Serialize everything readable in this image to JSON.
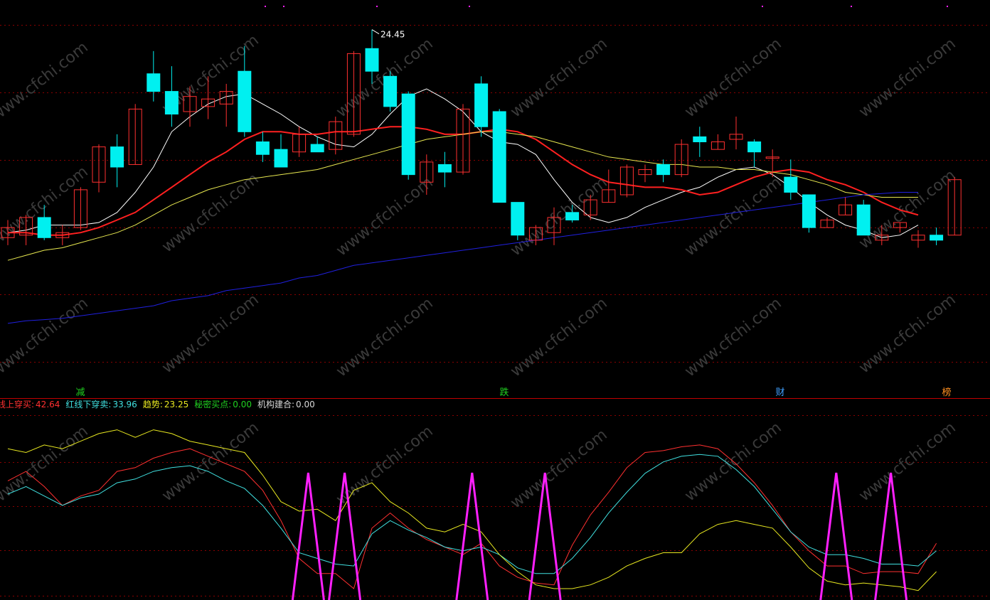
{
  "chart_data": [
    {
      "type": "candlestick",
      "peak_label": "24.45",
      "ylim": [
        10.4,
        25.4
      ],
      "moving_averages": [
        {
          "color": "#ffffff",
          "values": [
            16.4,
            16.5,
            16.7,
            16.7,
            16.7,
            16.8,
            17.2,
            18.0,
            19.0,
            20.4,
            21.0,
            21.5,
            21.8,
            21.9,
            21.5,
            21.1,
            20.6,
            20.2,
            19.9,
            19.8,
            20.3,
            21.1,
            21.8,
            22.1,
            21.7,
            21.2,
            20.4,
            20.0,
            19.9,
            19.5,
            18.5,
            17.6,
            17.0,
            16.8,
            17.0,
            17.4,
            17.7,
            18.0,
            18.2,
            18.6,
            18.9,
            19.0,
            18.7,
            18.2,
            17.6,
            17.1,
            16.7,
            16.5,
            16.2,
            16.3,
            16.7
          ]
        },
        {
          "color": "#ff2020",
          "values": [
            16.4,
            16.4,
            16.3,
            16.3,
            16.4,
            16.6,
            16.9,
            17.2,
            17.7,
            18.2,
            18.7,
            19.2,
            19.6,
            20.1,
            20.4,
            20.4,
            20.3,
            20.3,
            20.4,
            20.4,
            20.5,
            20.6,
            20.6,
            20.5,
            20.3,
            20.3,
            20.4,
            20.5,
            20.4,
            20.1,
            19.6,
            19.1,
            18.7,
            18.4,
            18.3,
            18.2,
            18.2,
            18.1,
            17.9,
            18.0,
            18.3,
            18.6,
            18.8,
            18.9,
            18.8,
            18.5,
            18.3,
            18.0,
            17.6,
            17.3,
            17.1
          ]
        },
        {
          "color": "#e8e850",
          "values": [
            15.3,
            15.5,
            15.7,
            15.8,
            16.0,
            16.2,
            16.4,
            16.7,
            17.1,
            17.5,
            17.8,
            18.1,
            18.3,
            18.5,
            18.6,
            18.7,
            18.8,
            18.9,
            19.1,
            19.3,
            19.5,
            19.7,
            19.9,
            20.1,
            20.2,
            20.3,
            20.4,
            20.4,
            20.3,
            20.2,
            20.0,
            19.8,
            19.6,
            19.4,
            19.3,
            19.2,
            19.1,
            19.1,
            19.0,
            19.0,
            18.9,
            18.9,
            18.8,
            18.7,
            18.5,
            18.3,
            18.0,
            17.9,
            17.8,
            17.8,
            17.8
          ]
        },
        {
          "color": "#2020e0",
          "values": [
            12.8,
            12.9,
            12.95,
            13.0,
            13.1,
            13.2,
            13.3,
            13.4,
            13.5,
            13.7,
            13.8,
            13.9,
            14.1,
            14.2,
            14.3,
            14.4,
            14.6,
            14.7,
            14.9,
            15.1,
            15.2,
            15.3,
            15.4,
            15.5,
            15.6,
            15.7,
            15.8,
            15.9,
            16.0,
            16.1,
            16.2,
            16.3,
            16.4,
            16.5,
            16.6,
            16.7,
            16.8,
            16.9,
            17.0,
            17.1,
            17.2,
            17.3,
            17.4,
            17.5,
            17.6,
            17.7,
            17.8,
            17.9,
            17.95,
            18.0,
            18.0
          ]
        }
      ],
      "candles": [
        {
          "o": 16.2,
          "h": 16.9,
          "l": 15.9,
          "c": 16.6
        },
        {
          "o": 16.3,
          "h": 17.1,
          "l": 15.9,
          "c": 17.0
        },
        {
          "o": 17.0,
          "h": 17.5,
          "l": 16.1,
          "c": 16.2
        },
        {
          "o": 16.2,
          "h": 16.7,
          "l": 15.9,
          "c": 16.4
        },
        {
          "o": 16.6,
          "h": 18.2,
          "l": 16.5,
          "c": 18.1
        },
        {
          "o": 18.4,
          "h": 19.9,
          "l": 18.0,
          "c": 19.8
        },
        {
          "o": 19.8,
          "h": 20.3,
          "l": 18.2,
          "c": 19.0
        },
        {
          "o": 19.1,
          "h": 21.5,
          "l": 19.1,
          "c": 21.3
        },
        {
          "o": 22.7,
          "h": 23.6,
          "l": 21.6,
          "c": 22.0
        },
        {
          "o": 22.0,
          "h": 23.0,
          "l": 20.6,
          "c": 21.1
        },
        {
          "o": 21.2,
          "h": 22.2,
          "l": 20.6,
          "c": 21.8
        },
        {
          "o": 21.4,
          "h": 22.6,
          "l": 20.9,
          "c": 21.7
        },
        {
          "o": 21.5,
          "h": 22.3,
          "l": 20.6,
          "c": 22.0
        },
        {
          "o": 22.8,
          "h": 23.8,
          "l": 20.2,
          "c": 20.4
        },
        {
          "o": 20.0,
          "h": 20.4,
          "l": 19.2,
          "c": 19.5
        },
        {
          "o": 19.7,
          "h": 20.3,
          "l": 19.1,
          "c": 19.0
        },
        {
          "o": 19.6,
          "h": 20.6,
          "l": 19.4,
          "c": 20.3
        },
        {
          "o": 19.9,
          "h": 20.2,
          "l": 19.7,
          "c": 19.6
        },
        {
          "o": 19.7,
          "h": 21.0,
          "l": 19.5,
          "c": 20.8
        },
        {
          "o": 20.3,
          "h": 23.6,
          "l": 20.2,
          "c": 23.5
        },
        {
          "o": 23.7,
          "h": 24.45,
          "l": 22.3,
          "c": 22.8
        },
        {
          "o": 22.6,
          "h": 22.8,
          "l": 21.2,
          "c": 21.4
        },
        {
          "o": 21.9,
          "h": 22.0,
          "l": 18.5,
          "c": 18.7
        },
        {
          "o": 18.4,
          "h": 19.5,
          "l": 17.9,
          "c": 19.2
        },
        {
          "o": 19.1,
          "h": 19.6,
          "l": 18.2,
          "c": 18.8
        },
        {
          "o": 18.8,
          "h": 21.5,
          "l": 18.7,
          "c": 21.3
        },
        {
          "o": 22.3,
          "h": 22.6,
          "l": 20.2,
          "c": 20.6
        },
        {
          "o": 21.2,
          "h": 21.3,
          "l": 17.6,
          "c": 17.6
        },
        {
          "o": 17.6,
          "h": 17.6,
          "l": 16.1,
          "c": 16.3
        },
        {
          "o": 16.1,
          "h": 16.7,
          "l": 15.9,
          "c": 16.6
        },
        {
          "o": 16.4,
          "h": 17.4,
          "l": 15.9,
          "c": 17.0
        },
        {
          "o": 17.2,
          "h": 17.5,
          "l": 16.8,
          "c": 16.9
        },
        {
          "o": 17.1,
          "h": 17.9,
          "l": 16.9,
          "c": 17.7
        },
        {
          "o": 17.6,
          "h": 18.9,
          "l": 17.6,
          "c": 18.1
        },
        {
          "o": 17.9,
          "h": 19.1,
          "l": 17.8,
          "c": 19.0
        },
        {
          "o": 18.7,
          "h": 19.1,
          "l": 18.4,
          "c": 18.9
        },
        {
          "o": 19.1,
          "h": 19.3,
          "l": 18.4,
          "c": 18.7
        },
        {
          "o": 18.7,
          "h": 20.1,
          "l": 18.6,
          "c": 19.9
        },
        {
          "o": 20.2,
          "h": 20.6,
          "l": 19.4,
          "c": 20.0
        },
        {
          "o": 19.7,
          "h": 20.3,
          "l": 19.7,
          "c": 20.0
        },
        {
          "o": 20.1,
          "h": 21.0,
          "l": 19.7,
          "c": 20.3
        },
        {
          "o": 20.0,
          "h": 20.1,
          "l": 19.0,
          "c": 19.6
        },
        {
          "o": 19.4,
          "h": 19.7,
          "l": 18.6,
          "c": 19.4
        },
        {
          "o": 18.6,
          "h": 19.3,
          "l": 17.7,
          "c": 18.0
        },
        {
          "o": 17.9,
          "h": 17.9,
          "l": 16.4,
          "c": 16.6
        },
        {
          "o": 16.6,
          "h": 17.0,
          "l": 16.6,
          "c": 16.9
        },
        {
          "o": 17.1,
          "h": 17.8,
          "l": 17.1,
          "c": 17.5
        },
        {
          "o": 17.5,
          "h": 17.7,
          "l": 16.3,
          "c": 16.3
        },
        {
          "o": 16.1,
          "h": 16.7,
          "l": 15.9,
          "c": 16.3
        },
        {
          "o": 16.6,
          "h": 16.8,
          "l": 16.4,
          "c": 16.8
        },
        {
          "o": 16.1,
          "h": 16.5,
          "l": 15.8,
          "c": 16.3
        },
        {
          "o": 16.3,
          "h": 16.6,
          "l": 15.9,
          "c": 16.1
        },
        {
          "o": 16.3,
          "h": 18.6,
          "l": 16.3,
          "c": 18.5
        }
      ]
    },
    {
      "type": "line",
      "ylim": [
        0,
        100
      ],
      "legend": [
        {
          "label": "线上穿买:",
          "value": "42.64",
          "color": "#ff3030"
        },
        {
          "label": "红线下穿卖:",
          "value": "33.96",
          "color": "#40e0e0"
        },
        {
          "label": "趋势:",
          "value": "23.25",
          "color": "#e8e820"
        },
        {
          "label": "秘密买点:",
          "value": "0.00",
          "color": "#20d020"
        },
        {
          "label": "机构建合:",
          "value": "0.00",
          "color": "#d8d8d8"
        }
      ],
      "series": [
        {
          "color": "#ff3030",
          "values": [
            63,
            68,
            60,
            50,
            55,
            58,
            68,
            70,
            75,
            78,
            80,
            76,
            72,
            68,
            58,
            42,
            22,
            14,
            14,
            6,
            38,
            46,
            38,
            32,
            28,
            24,
            30,
            18,
            12,
            9,
            8,
            29,
            45,
            57,
            70,
            78,
            79,
            81,
            82,
            80,
            72,
            62,
            50,
            36,
            26,
            18,
            18,
            14,
            15,
            15,
            14,
            30
          ]
        },
        {
          "color": "#40e0e0",
          "values": [
            56,
            60,
            55,
            50,
            54,
            56,
            62,
            64,
            68,
            70,
            71,
            68,
            63,
            59,
            50,
            38,
            25,
            22,
            19,
            18,
            35,
            42,
            37,
            33,
            28,
            26,
            28,
            24,
            17,
            14,
            14,
            22,
            33,
            46,
            57,
            67,
            73,
            76,
            77,
            76,
            69,
            60,
            48,
            36,
            28,
            24,
            24,
            22,
            19,
            19,
            18,
            26
          ]
        },
        {
          "color": "#e8e820",
          "values": [
            80,
            78,
            82,
            80,
            84,
            88,
            90,
            86,
            90,
            88,
            84,
            82,
            80,
            78,
            66,
            52,
            47,
            48,
            42,
            58,
            62,
            52,
            46,
            38,
            36,
            40,
            36,
            24,
            15,
            8,
            6,
            6,
            8,
            12,
            18,
            22,
            25,
            25,
            35,
            40,
            42,
            40,
            38,
            28,
            17,
            10,
            8,
            9,
            8,
            7,
            5,
            15
          ]
        }
      ],
      "spikes": [
        16.5,
        18.5,
        25.5,
        29.5,
        45.5,
        48.5
      ]
    }
  ],
  "signal_labels": [
    {
      "text": "减",
      "color": "#20d020"
    },
    {
      "text": "跌",
      "color": "#20d020"
    },
    {
      "text": "财",
      "color": "#40a0ff"
    },
    {
      "text": "榜",
      "color": "#ff9020"
    }
  ],
  "watermark": "www.cfchi.com",
  "colors": {
    "up": "#ff3030",
    "down": "#00f0f0",
    "grid": "#8a0000",
    "spike": "#ff20ff",
    "divider": "#c00000"
  }
}
